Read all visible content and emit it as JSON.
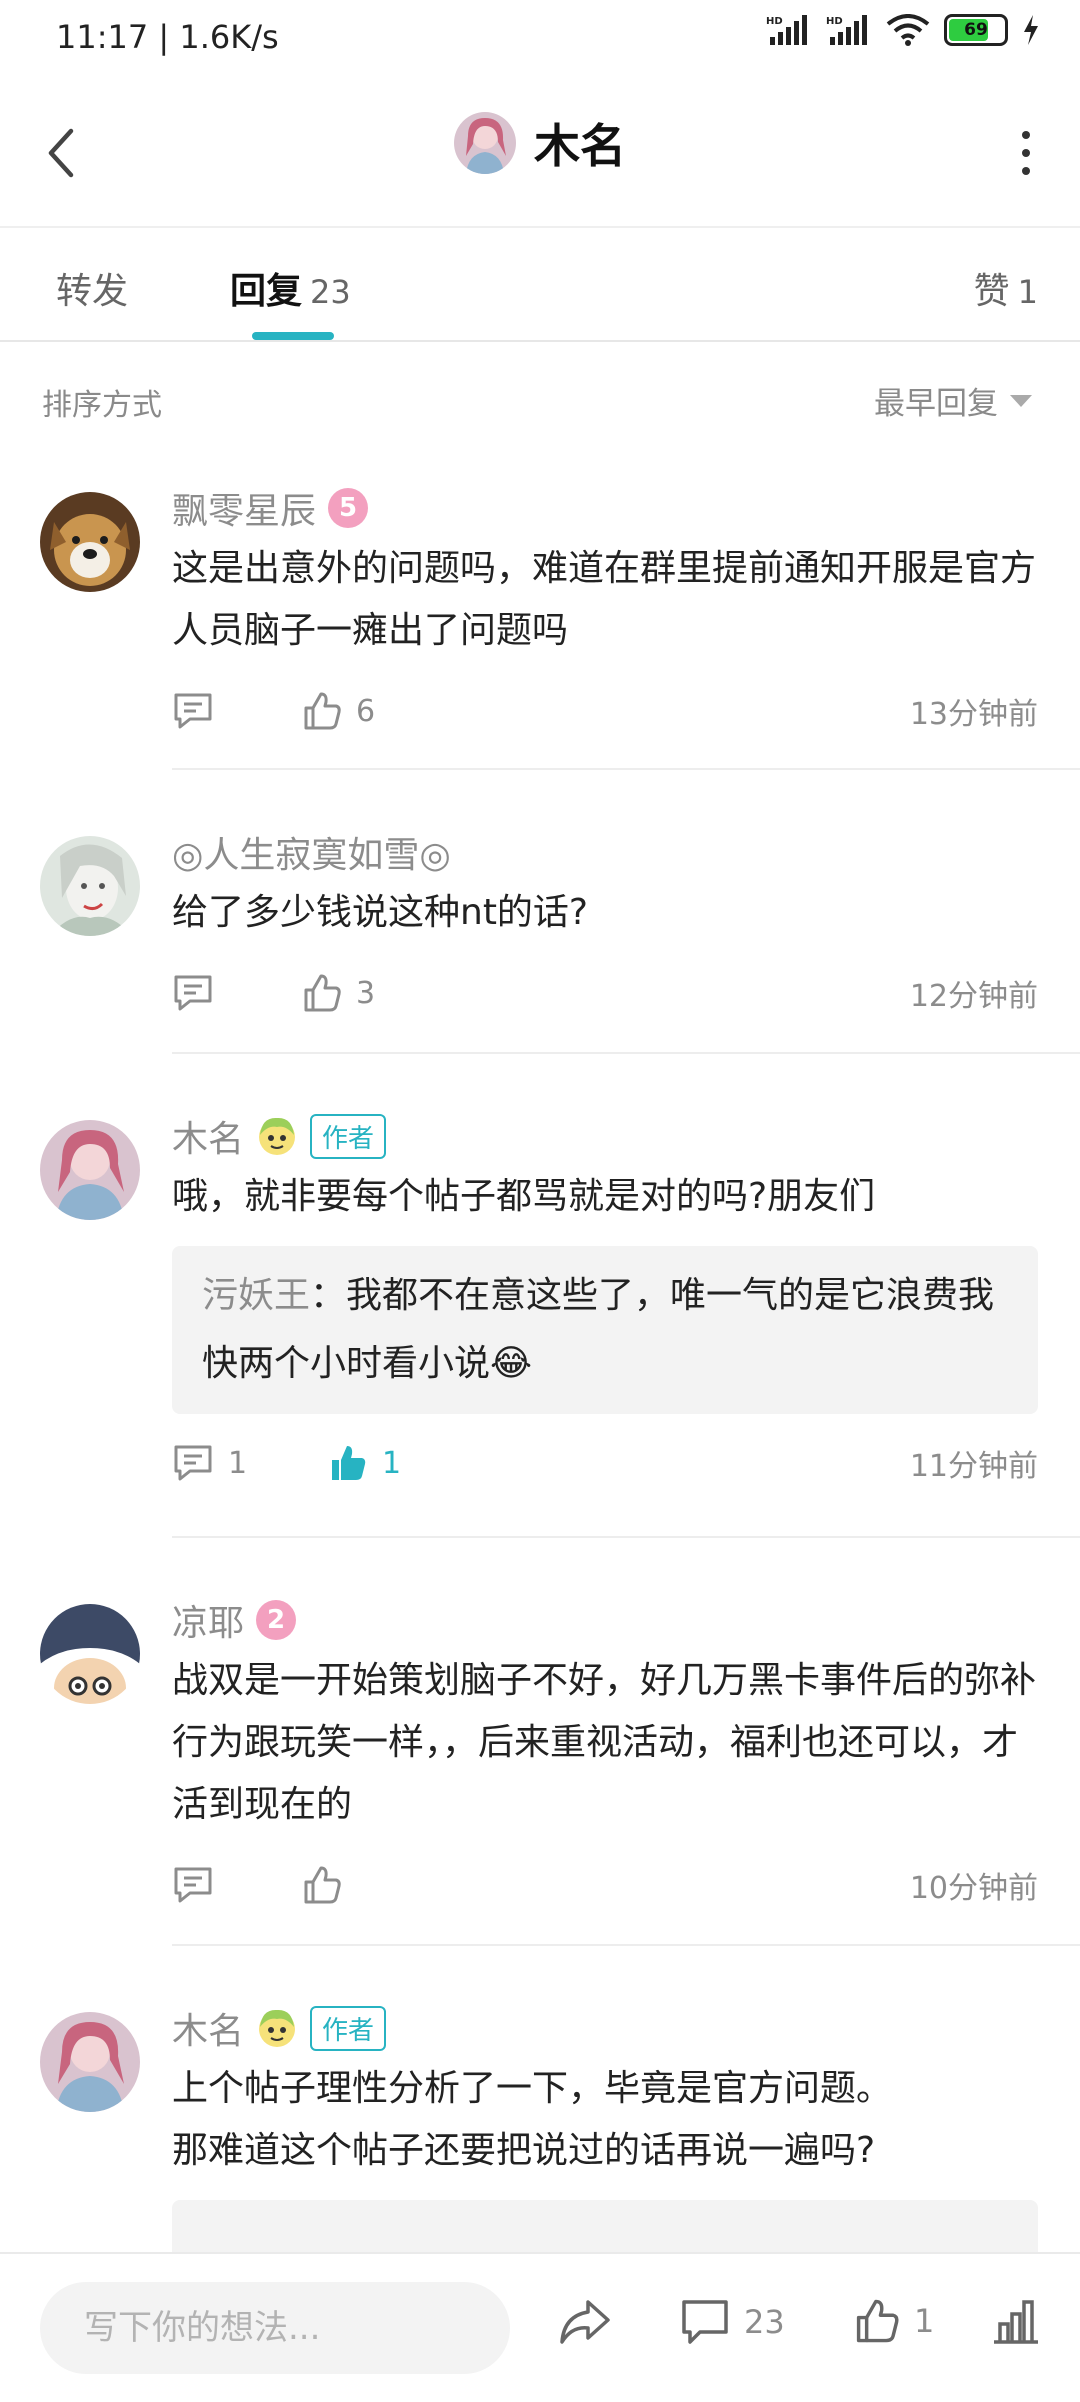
{
  "status_bar": {
    "time": "11:17 | 1.6K/s",
    "battery_level": "69"
  },
  "header": {
    "title": "木名"
  },
  "tabs": [
    {
      "label": "转发",
      "count": ""
    },
    {
      "label": "回复",
      "count": "23"
    },
    {
      "label": "赞",
      "count": "1"
    }
  ],
  "sort": {
    "label": "排序方式",
    "selected": "最早回复"
  },
  "comments": [
    {
      "user": "飘零星辰",
      "level": "5",
      "text": "这是出意外的问题吗，难道在群里提前通知开服是官方人员脑子一瘫出了问题吗",
      "reply_count": "",
      "like_count": "6",
      "time": "13分钟前"
    },
    {
      "user": "◎人生寂寞如雪◎",
      "text": "给了多少钱说这种nt的话?",
      "reply_count": "",
      "like_count": "3",
      "time": "12分钟前"
    },
    {
      "user": "木名",
      "author_tag": "作者",
      "text": "哦，就非要每个帖子都骂就是对的吗?朋友们",
      "quote_user": "污妖王",
      "quote_text": "：我都不在意这些了，唯一气的是它浪费我快两个小时看小说😂",
      "reply_count": "1",
      "like_count": "1",
      "time": "11分钟前"
    },
    {
      "user": "凉耶",
      "level": "2",
      "text": "战双是一开始策划脑子不好，好几万黑卡事件后的弥补行为跟玩笑一样，，后来重视活动，福利也还可以，才活到现在的",
      "reply_count": "",
      "like_count": "",
      "time": "10分钟前"
    },
    {
      "user": "木名",
      "author_tag": "作者",
      "text_line1": "上个帖子理性分析了一下，毕竟是官方问题。",
      "text_line2": "那难道这个帖子还要把说过的话再说一遍吗?"
    }
  ],
  "bottom_bar": {
    "input_placeholder": "写下你的想法...",
    "comment_count": "23",
    "like_count": "1"
  },
  "colors": {
    "accent": "#27b3c2",
    "level_badge": "#f3a0bf",
    "muted_text": "#8c8c8c"
  }
}
